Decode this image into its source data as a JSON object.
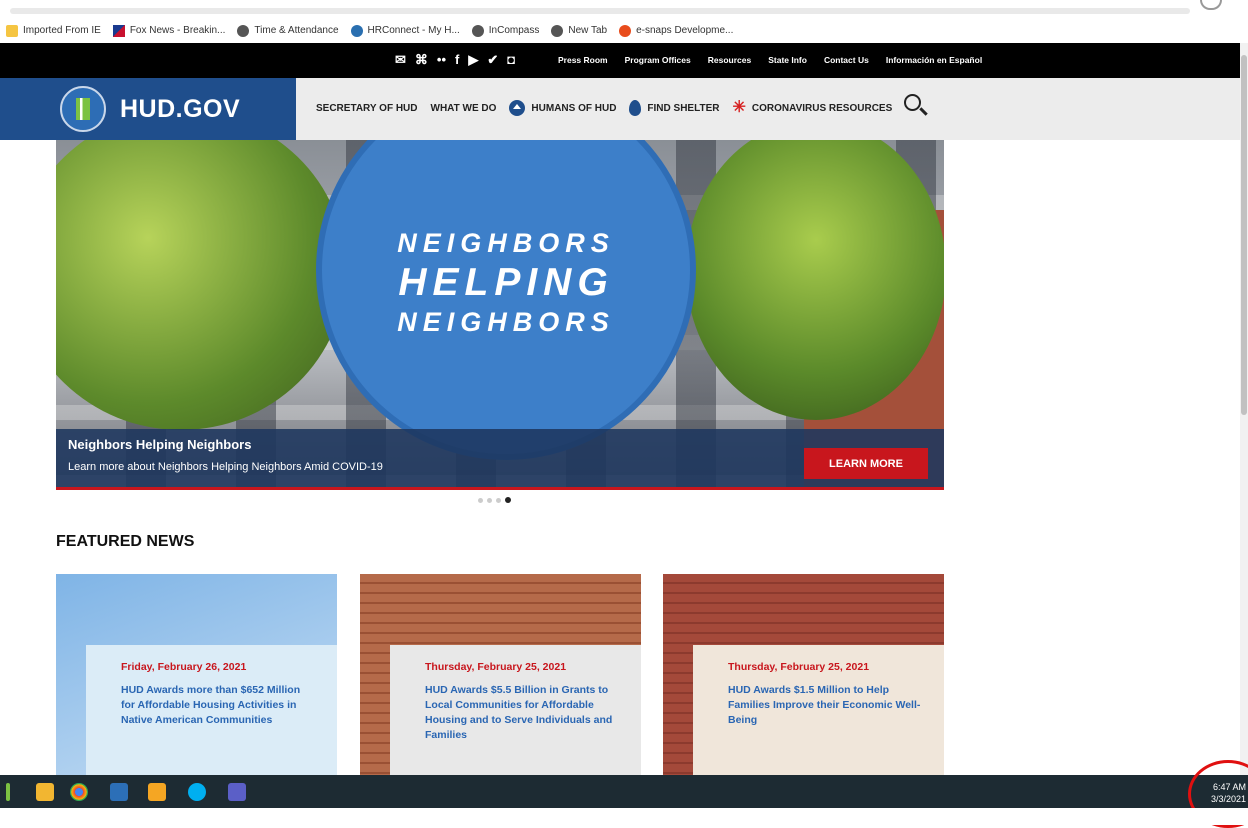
{
  "bookmarks": [
    {
      "label": "Imported From IE",
      "icon": "folder-icon"
    },
    {
      "label": "Fox News - Breakin...",
      "icon": "fox-icon"
    },
    {
      "label": "Time & Attendance",
      "icon": "globe-icon"
    },
    {
      "label": "HRConnect - My H...",
      "icon": "hr-icon"
    },
    {
      "label": "InCompass",
      "icon": "globe-icon"
    },
    {
      "label": "New Tab",
      "icon": "globe-icon"
    },
    {
      "label": "e-snaps Developme...",
      "icon": "esnaps-icon"
    }
  ],
  "utility": {
    "social": [
      "✉",
      "⌘",
      "••",
      "f",
      "▶",
      "✔",
      "◘"
    ],
    "links": [
      "Press Room",
      "Program Offices",
      "Resources",
      "State Info",
      "Contact Us",
      "Información en Español"
    ]
  },
  "header": {
    "brand": "HUD.GOV",
    "nav": [
      "SECRETARY OF HUD",
      "WHAT WE DO",
      "HUMANS OF HUD",
      "FIND SHELTER",
      "CORONAVIRUS RESOURCES"
    ]
  },
  "hero": {
    "line1": "NEIGHBORS",
    "line2": "HELPING",
    "line3": "NEIGHBORS",
    "caption_title": "Neighbors Helping Neighbors",
    "caption_sub": "Learn more about Neighbors Helping Neighbors Amid COVID-19",
    "button": "LEARN MORE",
    "slides": 4,
    "active_slide": 4
  },
  "featured": {
    "heading": "FEATURED NEWS",
    "cards": [
      {
        "date": "Friday, February 26, 2021",
        "headline": "HUD Awards more than $652 Million for Affordable Housing Activities in Native American Communities"
      },
      {
        "date": "Thursday, February 25, 2021",
        "headline": "HUD Awards $5.5 Billion in Grants to Local Communities for Affordable Housing and to Serve Individuals and Families"
      },
      {
        "date": "Thursday, February 25, 2021",
        "headline": "HUD Awards $1.5 Million to Help Families Improve their Economic Well-Being"
      }
    ]
  },
  "taskbar": {
    "time": "6:47 AM",
    "date": "3/3/2021",
    "apps": [
      "windows-icon",
      "file-explorer-icon",
      "chrome-icon",
      "remote-desktop-icon",
      "sticky-notes-icon",
      "skype-icon",
      "teams-icon"
    ]
  },
  "colors": {
    "hud_blue": "#1f4e8c",
    "accent_red": "#c8161d",
    "link_blue": "#2a66b3"
  }
}
